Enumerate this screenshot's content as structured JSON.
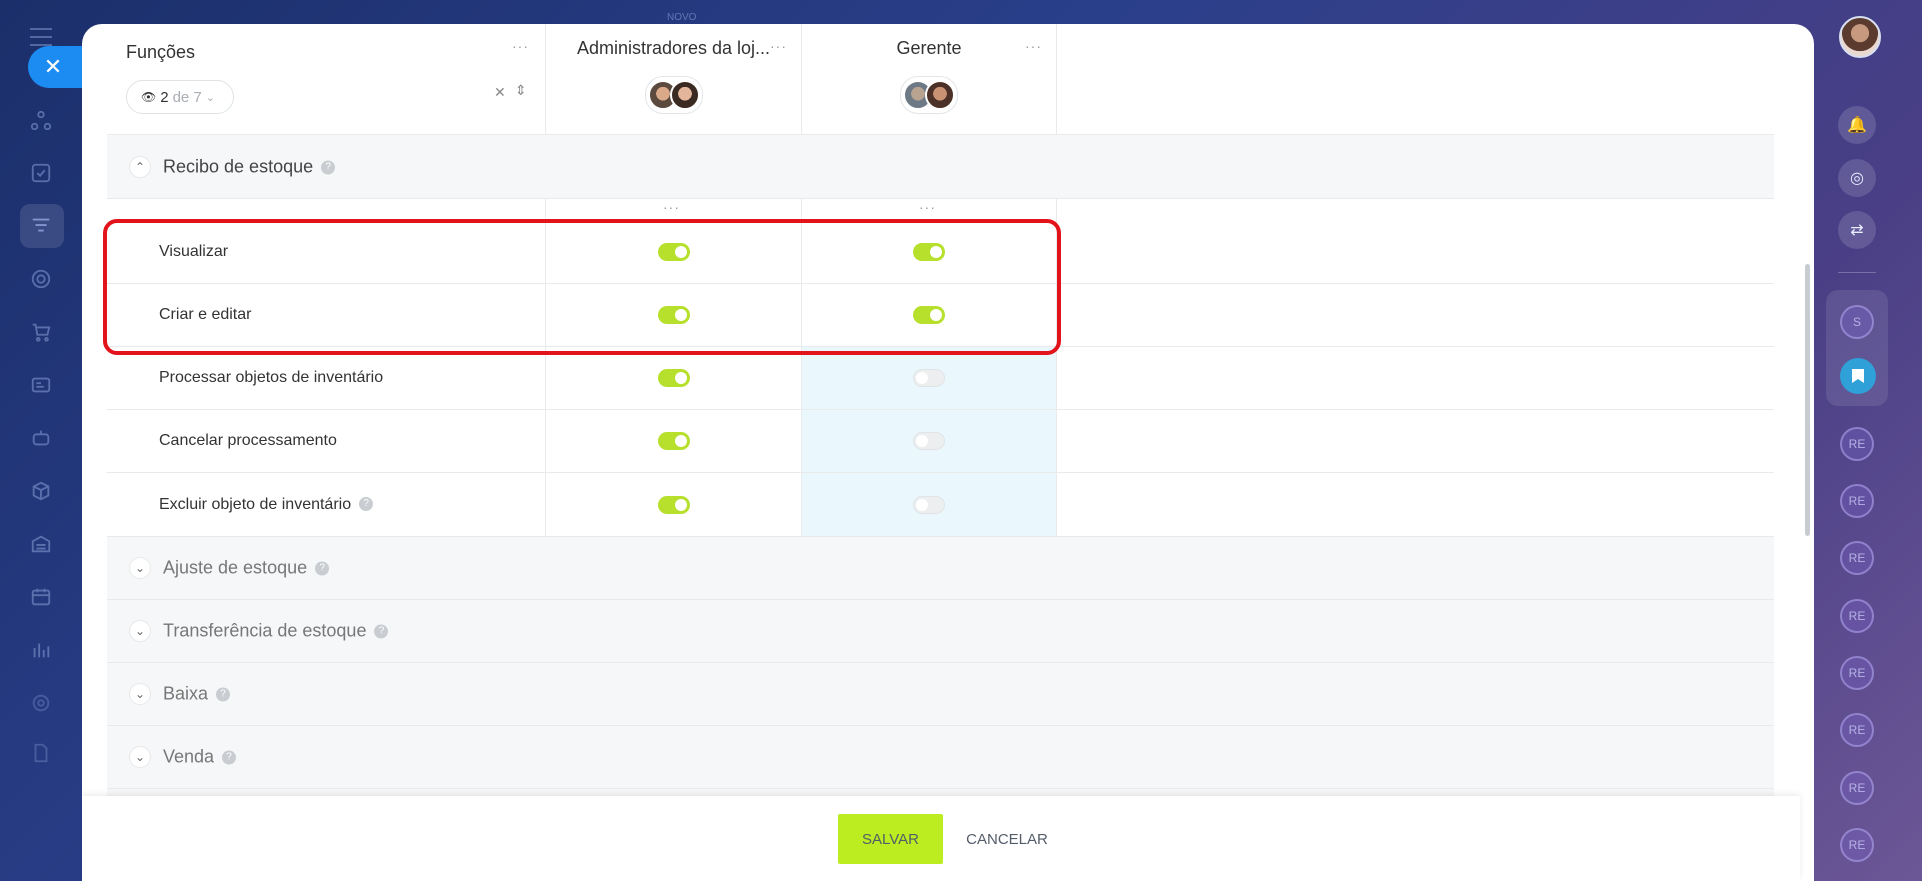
{
  "top": {
    "label": "NOVO"
  },
  "header": {
    "title": "Funções",
    "filter": {
      "count": "2",
      "of": "de 7"
    },
    "roles": [
      {
        "name": "Administradores da loj..."
      },
      {
        "name": "Gerente"
      }
    ]
  },
  "sections": [
    {
      "label": "Recibo de estoque",
      "expanded": true,
      "permissions": [
        {
          "label": "Visualizar",
          "admin": true,
          "manager": true
        },
        {
          "label": "Criar e editar",
          "admin": true,
          "manager": true
        },
        {
          "label": "Processar objetos de inventário",
          "admin": true,
          "manager": false
        },
        {
          "label": "Cancelar processamento",
          "admin": true,
          "manager": false
        },
        {
          "label": "Excluir objeto de inventário",
          "admin": true,
          "manager": false
        }
      ]
    },
    {
      "label": "Ajuste de estoque",
      "expanded": false
    },
    {
      "label": "Transferência de estoque",
      "expanded": false
    },
    {
      "label": "Baixa",
      "expanded": false
    },
    {
      "label": "Venda",
      "expanded": false
    }
  ],
  "help_glyph": "?",
  "footer": {
    "save_label": "SALVAR",
    "cancel_label": "CANCELAR"
  },
  "rail": {
    "s": "S",
    "re": "RE"
  },
  "colors": {
    "toggle_on": "#b6e02c",
    "highlight": "#e3131b",
    "save": "#bbed21",
    "accent": "#1c8cf3"
  }
}
